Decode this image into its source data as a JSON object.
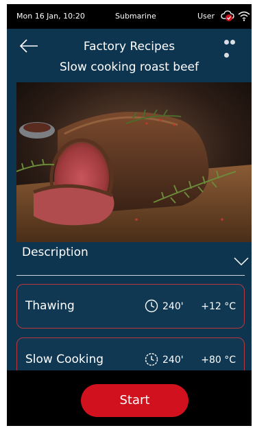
{
  "statusbar": {
    "datetime": "Mon 16 Jan, 10:20",
    "mode": "Submarine",
    "user": "User"
  },
  "header": {
    "title": "Factory Recipes",
    "subtitle": "Slow cooking roast beef"
  },
  "description": {
    "label": "Description"
  },
  "steps": [
    {
      "name": "Thawing",
      "time": "240'",
      "temperature": "+12 °C",
      "icon": "clock-icon"
    },
    {
      "name": "Slow Cooking",
      "time": "240'",
      "temperature": "+80 °C",
      "icon": "slow-clock-icon"
    }
  ],
  "actions": {
    "start_label": "Start"
  },
  "colors": {
    "background": "#0e3550",
    "accent": "#d2111e",
    "step_border": "#b8383f"
  }
}
